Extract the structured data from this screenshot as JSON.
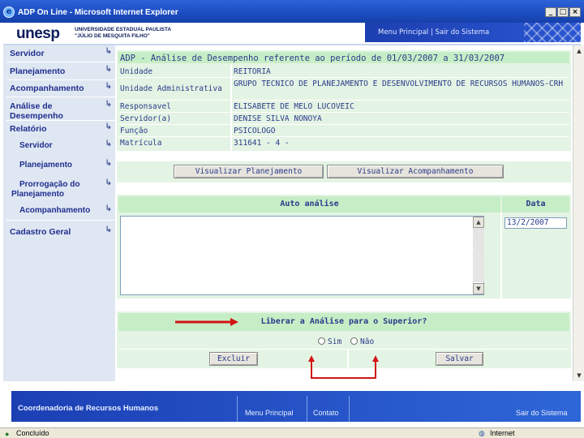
{
  "window": {
    "title": "ADP On Line - Microsoft Internet Explorer"
  },
  "header": {
    "logo": "unesp",
    "university_line1": "UNIVERSIDADE ESTADUAL PAULISTA",
    "university_line2": "\"JÚLIO DE MESQUITA FILHO\"",
    "link_menu": "Menu Principal",
    "link_separator": "|",
    "link_exit": "Sair do Sistema"
  },
  "sidebar": {
    "items": [
      {
        "label": "Servidor"
      },
      {
        "label": "Planejamento"
      },
      {
        "label": "Acompanhamento"
      },
      {
        "label": "Análise de Desempenho"
      },
      {
        "label": "Relatório"
      },
      {
        "label": "Servidor"
      },
      {
        "label": "Planejamento"
      },
      {
        "label": "Prorrogação do Planejamento"
      },
      {
        "label": "Acompanhamento"
      },
      {
        "label": "Cadastro Geral"
      }
    ]
  },
  "info": {
    "title": "ADP - Análise de Desempenho referente ao período de 01/03/2007 a 31/03/2007",
    "rows": [
      {
        "label": "Unidade",
        "value": "REITORIA"
      },
      {
        "label": "Unidade Administrativa",
        "value": "GRUPO TÉCNICO DE PLANEJAMENTO E DESENVOLVIMENTO DE RECURSOS HUMANOS-CRH"
      },
      {
        "label": "Responsavel",
        "value": "ELISABETE DE MELO LUCOVEIC"
      },
      {
        "label": "Servidor(a)",
        "value": "DENISE SILVA NONOYA"
      },
      {
        "label": "Função",
        "value": "PSICOLOGO"
      },
      {
        "label": "Matrícula",
        "value": "311641 - 4 -"
      }
    ]
  },
  "actions": {
    "view_plan": "Visualizar Planejamento",
    "view_followup": "Visualizar Acompanhamento"
  },
  "self_analysis": {
    "header": "Auto análise",
    "date_header": "Data",
    "text": "",
    "date": "13/2/2007"
  },
  "release": {
    "question": "Liberar a Análise para o Superior?",
    "yes": "Sim",
    "no": "Não",
    "delete": "Excluir",
    "save": "Salvar"
  },
  "footer": {
    "title": "Coordenadoria de Recursos Humanos",
    "menu": "Menu Principal",
    "contact": "Contato",
    "exit": "Sair do Sistema"
  },
  "status": {
    "left": "Concluído",
    "right": "Internet"
  },
  "colors": {
    "panel": "#e4f4e4",
    "panel_header": "#c6eec6",
    "sidebar": "#dfe7f2",
    "annotation": "#d21414",
    "brand_blue": "#1c3fb4"
  }
}
